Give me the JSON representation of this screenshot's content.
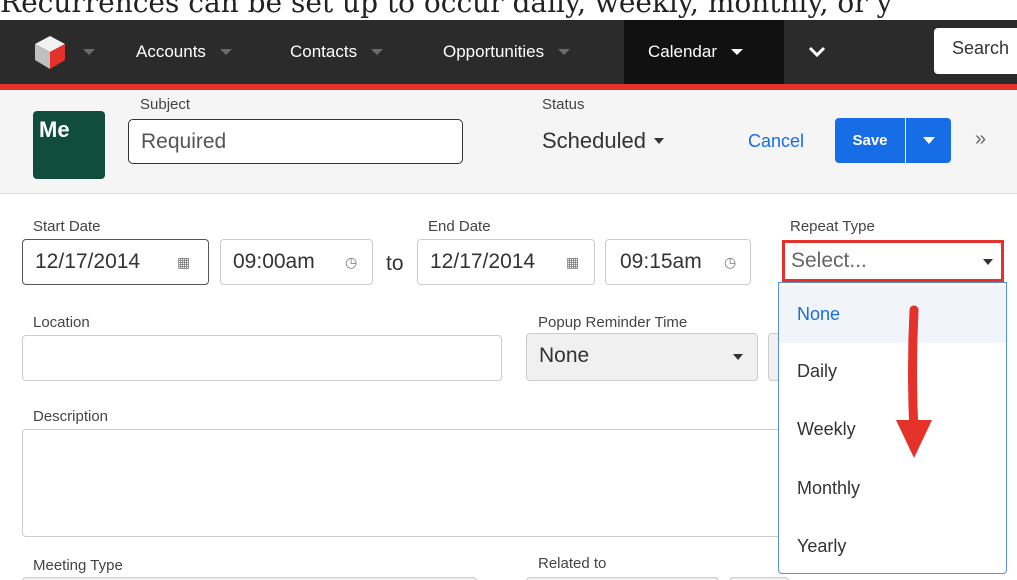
{
  "caption": "Recurrences can be set up to occur daily, weekly, monthly, or y",
  "nav": {
    "items": [
      {
        "label": "Accounts"
      },
      {
        "label": "Contacts"
      },
      {
        "label": "Opportunities"
      },
      {
        "label": "Calendar",
        "active": true
      }
    ],
    "search_placeholder": "Search"
  },
  "header": {
    "avatar": "Me",
    "subject_label": "Subject",
    "subject_placeholder": "Required",
    "status_label": "Status",
    "status_value": "Scheduled",
    "cancel": "Cancel",
    "save": "Save"
  },
  "form": {
    "start_date_label": "Start Date",
    "start_date": "12/17/2014",
    "start_time": "09:00am",
    "to": "to",
    "end_date_label": "End Date",
    "end_date": "12/17/2014",
    "end_time": "09:15am",
    "repeat_type_label": "Repeat Type",
    "repeat_type_value": "Select...",
    "location_label": "Location",
    "location_value": "",
    "popup_reminder_label": "Popup Reminder Time",
    "popup_reminder_value": "None",
    "description_label": "Description",
    "meeting_type_label": "Meeting Type",
    "related_to_label": "Related to"
  },
  "repeat_dropdown": {
    "options": [
      "None",
      "Daily",
      "Weekly",
      "Monthly",
      "Yearly"
    ],
    "selected": "None"
  },
  "colors": {
    "nav_bg": "#2b2b2b",
    "brand_red": "#e4322b",
    "accent_blue": "#176de5",
    "avatar_green": "#114d3d",
    "arrow_red": "#e4322b"
  },
  "icons": [
    "logo-cube-icon",
    "calendar-icon",
    "clock-icon",
    "chevron-down-icon",
    "expand-icon",
    "down-arrow-annotation"
  ]
}
